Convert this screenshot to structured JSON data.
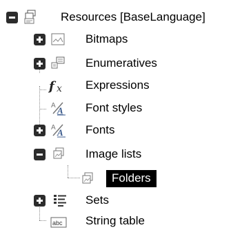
{
  "tree": {
    "root": {
      "label": "Resources [BaseLanguage]",
      "expanded": true,
      "icon": "resources-icon"
    },
    "items": [
      {
        "label": "Bitmaps",
        "icon": "bitmap-icon",
        "expander": "plus"
      },
      {
        "label": "Enumeratives",
        "icon": "enumeratives-icon",
        "expander": "plus"
      },
      {
        "label": "Expressions",
        "icon": "function-icon",
        "expander": "none"
      },
      {
        "label": "Font styles",
        "icon": "font-style-icon",
        "expander": "none"
      },
      {
        "label": "Fonts",
        "icon": "font-icon",
        "expander": "plus"
      },
      {
        "label": "Image lists",
        "icon": "image-list-icon",
        "expander": "minus",
        "children": [
          {
            "label": "Folders",
            "icon": "image-list-icon",
            "selected": true
          }
        ]
      },
      {
        "label": "Sets",
        "icon": "sets-icon",
        "expander": "plus"
      },
      {
        "label": "String table",
        "icon": "string-table-icon",
        "expander": "none"
      }
    ]
  }
}
